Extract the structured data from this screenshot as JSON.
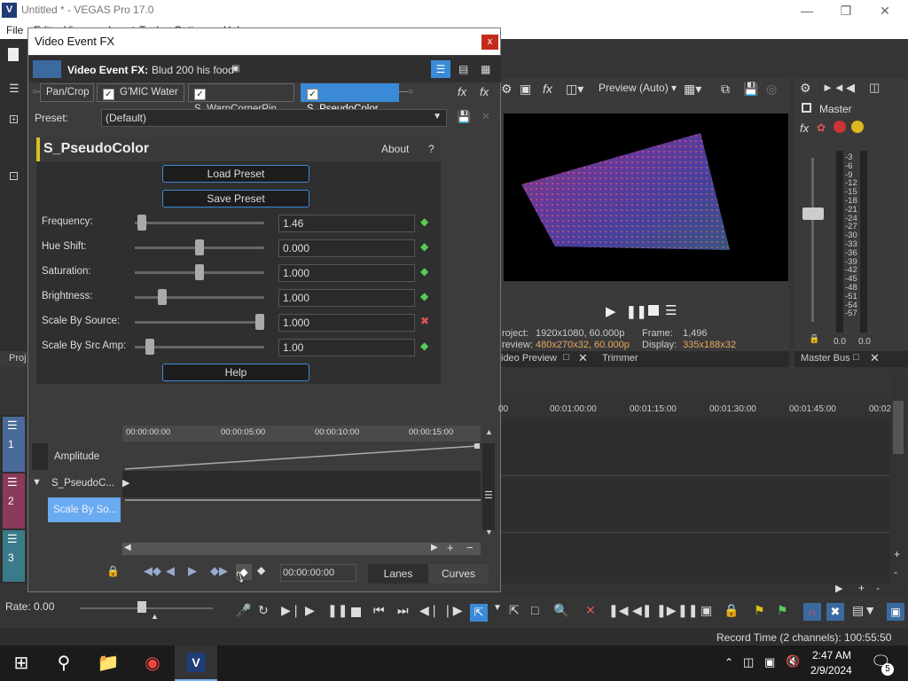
{
  "app": {
    "logo_text": "V",
    "title": "Untitled * - VEGAS Pro 17.0",
    "menu": [
      "File",
      "Edit",
      "View",
      "Insert",
      "Tools",
      "Options",
      "Help"
    ]
  },
  "dialog": {
    "title": "Video Event FX",
    "close_label": "x",
    "header_label": "Video Event FX:",
    "header_event": "Blud 200 his food",
    "fx_chain": [
      {
        "label": "Pan/Crop",
        "checked": false,
        "selected": false
      },
      {
        "label": "G'MIC Water",
        "checked": true,
        "selected": false
      },
      {
        "label": "S_WarpCornerPin",
        "checked": true,
        "selected": false
      },
      {
        "label": "S_PseudoColor",
        "checked": true,
        "selected": true
      }
    ],
    "preset_label": "Preset:",
    "preset_value": "(Default)",
    "plugin": {
      "name": "S_PseudoColor",
      "about": "About",
      "help_q": "?",
      "load_preset": "Load Preset",
      "save_preset": "Save Preset",
      "help": "Help",
      "params": [
        {
          "label": "Frequency:",
          "value": "1.46",
          "pos": 0.02
        },
        {
          "label": "Hue Shift:",
          "value": "0.000",
          "pos": 0.5
        },
        {
          "label": "Saturation:",
          "value": "1.000",
          "pos": 0.5
        },
        {
          "label": "Brightness:",
          "value": "1.000",
          "pos": 0.19
        },
        {
          "label": "Scale By Source:",
          "value": "1.000",
          "pos": 1.0
        },
        {
          "label": "Scale By Src Amp:",
          "value": "1.00",
          "pos": 0.09
        }
      ]
    },
    "keyframes": {
      "ticks": [
        "00:00:00:00",
        "00:00:05:00",
        "00:00:10:00",
        "00:00:15:00"
      ],
      "rows": [
        "Amplitude",
        "S_PseudoC...",
        "Scale By So..."
      ],
      "time": "00:00:00:00",
      "lanes": "Lanes",
      "curves": "Curves"
    }
  },
  "preview": {
    "mode": "Preview (Auto)",
    "project_label": "roject:",
    "project_value": "1920x1080, 60.000p",
    "preview_label": "review:",
    "preview_value": "480x270x32, 60.000p",
    "frame_label": "Frame:",
    "frame_value": "1,496",
    "display_label": "Display:",
    "display_value": "335x188x32",
    "tab1": "ideo Preview",
    "tab2": "Trimmer"
  },
  "master": {
    "label": "Master",
    "bus_tab": "Master Bus",
    "scale": [
      "3",
      "6",
      "9",
      "12",
      "15",
      "18",
      "21",
      "24",
      "27",
      "30",
      "33",
      "36",
      "39",
      "42",
      "45",
      "48",
      "51",
      "54",
      "57"
    ],
    "left_val": "0.0",
    "right_val": "0.0"
  },
  "timeline": {
    "ticks": [
      "00",
      "00:01:00:00",
      "00:01:15:00",
      "00:01:30:00",
      "00:01:45:00",
      "00:02"
    ],
    "tracks": [
      "1",
      "2",
      "3"
    ]
  },
  "left_panel": {
    "proj_tab": "Proj"
  },
  "transport": {
    "rate": "Rate: 0.00"
  },
  "status": {
    "record_time": "Record Time (2 channels): 100:55:50"
  },
  "taskbar": {
    "time": "2:47 AM",
    "date": "2/9/2024",
    "notif_count": "5"
  }
}
